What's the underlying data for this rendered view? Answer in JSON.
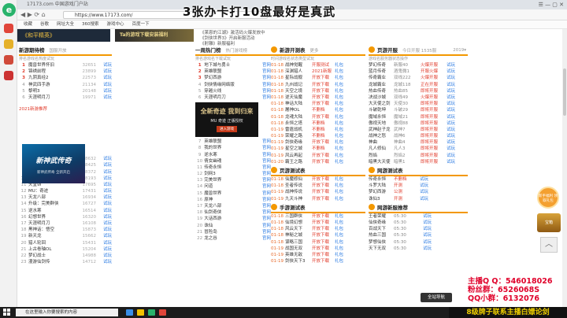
{
  "browser": {
    "tab_title": "17173.com 中国游戏门户站",
    "url": "https://www.17173.com/",
    "nav_glyphs": "◀ ▶ ⟳ ⌂",
    "win_controls": "☰ — ▢ ✕"
  },
  "bookmarks": [
    "收藏",
    "谷歌",
    "网址大全",
    "360搜索",
    "游戏中心",
    "百度一下"
  ],
  "banner": "《和平精英》",
  "fengkuang": "Ta的游戏下载安装福利",
  "top_notes": [
    "《莱恩的江湖》激活码火爆发放中",
    "《剑侠世界3》开启新服活动",
    "《射雕》新服福利"
  ],
  "overlay_title": "3张办卡打10盘最好是真武",
  "col1": {
    "title": "新游期待榜",
    "sub": "国服开放",
    "hdr": [
      "排名",
      "游戏名",
      "热度",
      "试玩"
    ],
    "rows": [
      [
        "1",
        "魔兽世界怀旧",
        "32651",
        "试玩"
      ],
      [
        "2",
        "锦绣前程",
        "23899",
        "试玩"
      ],
      [
        "3",
        "九阴真经2",
        "22573",
        "试玩"
      ],
      [
        "4",
        "神武四手游",
        "21134",
        "试玩"
      ],
      [
        "5",
        "黎明3",
        "20148",
        "试玩"
      ],
      [
        "6",
        "天涯明月刀",
        "19971",
        "试玩"
      ]
    ],
    "ad_title": "2021新游推荐",
    "img_text": "新神武传奇",
    "img_cap": "新神武传奇 全新开启",
    "rows2": [
      [
        "7",
        "神谱",
        "18632",
        "试玩"
      ],
      [
        "8",
        "流星蝴蝶剑",
        "18425",
        "试玩"
      ],
      [
        "9",
        "BBQ欢乐",
        "18372",
        "试玩"
      ],
      [
        "10",
        "提灯与地下城",
        "18193",
        "试玩"
      ],
      [
        "11",
        "天堂W",
        "17695",
        "试玩"
      ],
      [
        "12",
        "MU：奇迹",
        "17431",
        "试玩"
      ],
      [
        "13",
        "天龙八部",
        "16934",
        "试玩"
      ],
      [
        "14",
        "升级：完美群侠",
        "16727",
        "试玩"
      ],
      [
        "15",
        "逆水寒",
        "16514",
        "试玩"
      ],
      [
        "16",
        "幻想世界",
        "16320",
        "试玩"
      ],
      [
        "17",
        "天涯明月刀",
        "16108",
        "试玩"
      ],
      [
        "18",
        "黑神话：悟空",
        "15873",
        "试玩"
      ],
      [
        "19",
        "新天龙",
        "15662",
        "试玩"
      ],
      [
        "20",
        "猎人轮回",
        "15431",
        "试玩"
      ],
      [
        "21",
        "上古卷轴OL",
        "15204",
        "试玩"
      ],
      [
        "22",
        "梦幻战士",
        "14988",
        "试玩"
      ],
      [
        "23",
        "漫游仙剑传",
        "14712",
        "试玩"
      ]
    ]
  },
  "col2": {
    "title": "一周热门榜",
    "sub": "热门游戏榜",
    "hdr": [
      "排名",
      "游戏名",
      "下载",
      "试玩"
    ],
    "rows": [
      [
        "1",
        "地下城与勇士",
        "",
        "官网"
      ],
      [
        "2",
        "英雄联盟",
        "",
        "官网"
      ],
      [
        "3",
        "梦幻西游",
        "",
        "官网"
      ],
      [
        "4",
        "剑侠情缘网络版",
        "",
        "官网"
      ],
      [
        "5",
        "穿越火线",
        "",
        "官网"
      ],
      [
        "6",
        "天涯明月刀",
        "",
        "官网"
      ]
    ],
    "mu_title": "全新奇迹 我到归来",
    "mu_sub": "MU 奇迹 正版授权",
    "mu_btn": "进入游戏",
    "rows2": [
      [
        "7",
        "英雄联盟",
        "",
        "官网"
      ],
      [
        "8",
        "我的世界",
        "",
        "官网"
      ],
      [
        "9",
        "逆水寒",
        "",
        "官网"
      ],
      [
        "10",
        "倩女幽魂",
        "",
        "官网"
      ],
      [
        "11",
        "传奇永恒",
        "",
        "官网"
      ],
      [
        "12",
        "剑网3",
        "",
        "官网"
      ],
      [
        "13",
        "完美世界",
        "",
        "官网"
      ],
      [
        "14",
        "问道",
        "",
        "官网"
      ],
      [
        "15",
        "魔兽世界",
        "",
        "官网"
      ],
      [
        "16",
        "原神",
        "",
        "官网"
      ],
      [
        "17",
        "天龙八部",
        "",
        "官网"
      ],
      [
        "18",
        "仙剑奇侠",
        "",
        "官网"
      ],
      [
        "19",
        "大话西游",
        "",
        "官网"
      ],
      [
        "20",
        "诛仙",
        "",
        "官网"
      ],
      [
        "21",
        "冒险岛",
        "",
        "官网"
      ],
      [
        "22",
        "龙之谷",
        "",
        "官网"
      ]
    ]
  },
  "col3": {
    "title": "新游开测表",
    "more": "更多",
    "hdr": [
      "时间",
      "游戏名",
      "状态",
      "类型",
      "试玩"
    ],
    "rows": [
      [
        "01-18",
        "战神觉醒",
        "开服测试",
        "礼包"
      ],
      [
        "01-18",
        "深渊猎人",
        "2021新服",
        "礼包"
      ],
      [
        "01-18",
        "星际战舰",
        "开放下载",
        "礼包"
      ],
      [
        "01-18",
        "九州战记",
        "开放下载",
        "礼包"
      ],
      [
        "01-18",
        "天空之境",
        "开放下载",
        "礼包"
      ],
      [
        "01-18",
        "逆天仙魔",
        "开放下载",
        "礼包"
      ],
      [
        "01-18",
        "神话大陆",
        "开放下载",
        "礼包"
      ],
      [
        "01-18",
        "屠神OL",
        "不删档",
        "礼包"
      ],
      [
        "01-18",
        "龙魂大陆",
        "开放下载",
        "礼包"
      ],
      [
        "01-18",
        "永恒之塔",
        "不删档",
        "礼包"
      ],
      [
        "01-19",
        "雷霆战机",
        "不删档",
        "礼包"
      ],
      [
        "01-19",
        "荣耀之路",
        "不删档",
        "礼包"
      ],
      [
        "01-19",
        "剑侠奇缘",
        "开放下载",
        "礼包"
      ],
      [
        "01-19",
        "星空之城",
        "不删档",
        "礼包"
      ],
      [
        "01-19",
        "风云再起",
        "开放下载",
        "礼包"
      ],
      [
        "01-20",
        "霸王之路",
        "开放下载",
        "礼包"
      ]
    ],
    "sec2": "页游测试表",
    "rows2": [
      [
        "01-18",
        "仙魔修仙",
        "开放下载",
        "礼包"
      ],
      [
        "01-18",
        "圣者传说",
        "开放下载",
        "礼包"
      ],
      [
        "01-19",
        "战神传说",
        "开放下载",
        "礼包"
      ],
      [
        "01-19",
        "九天斗神",
        "开放下载",
        "礼包"
      ]
    ],
    "sec3": "手游测试表",
    "rows3": [
      [
        "01-18",
        "三国群侠",
        "开放下载",
        "礼包"
      ],
      [
        "01-18",
        "仙境幻想",
        "开放下载",
        "礼包"
      ],
      [
        "01-18",
        "风云天下",
        "开放下载",
        "礼包"
      ],
      [
        "01-18",
        "神秘之城",
        "开放下载",
        "礼包"
      ],
      [
        "01-18",
        "谋略三国",
        "开放下载",
        "礼包"
      ],
      [
        "01-19",
        "战国无双",
        "开放下载",
        "礼包"
      ],
      [
        "01-19",
        "英雄无敌",
        "开放下载",
        "礼包"
      ],
      [
        "01-19",
        "剑侠天下3",
        "开放下载",
        "礼包"
      ]
    ]
  },
  "col4": {
    "title": "页游开服",
    "sub": "今日开服 1535服",
    "more": "2019▾",
    "hdr": [
      "游戏名",
      "服务器",
      "状态",
      "操作"
    ],
    "rows": [
      [
        "梦幻传奇",
        "新服40",
        "火爆开服",
        "试玩"
      ],
      [
        "蓝月传奇",
        "酒鬼微1",
        "开服火爆",
        "试玩"
      ],
      [
        "传奇霸业",
        "双线222",
        "火爆开服",
        "试玩"
      ],
      [
        "龙城霸业",
        "龙城118",
        "正在开服",
        "试玩"
      ],
      [
        "热血传奇",
        "热血85",
        "即将开服",
        "试玩"
      ],
      [
        "决战沙城",
        "双线49",
        "火爆开服",
        "试玩"
      ],
      [
        "大天使之剑",
        "天使30",
        "即将开服",
        "试玩"
      ],
      [
        "斗破乾坤",
        "斗破29",
        "即将开服",
        "试玩"
      ],
      [
        "魔域永恒",
        "魔域21",
        "即将开服",
        "试玩"
      ],
      [
        "傲视天地",
        "傲视88",
        "即将开服",
        "试玩"
      ],
      [
        "武神赵子龙",
        "武神7",
        "即将开服",
        "试玩"
      ],
      [
        "战神之怒",
        "战神6",
        "即将开服",
        "试玩"
      ],
      [
        "神曲",
        "神曲4",
        "即将开服",
        "试玩"
      ],
      [
        "凡人修仙",
        "凡人3",
        "即将开服",
        "试玩"
      ],
      [
        "烈焰",
        "烈焰2",
        "即将开服",
        "试玩"
      ],
      [
        "暗黑大天使",
        "暗黑1",
        "即将开服",
        "试玩"
      ]
    ],
    "sec2": "网游测试表",
    "rows2": [
      [
        "传奇永恒",
        "不删档",
        "试玩"
      ],
      [
        "斗罗大陆",
        "开测",
        "试玩"
      ],
      [
        "梦幻西游",
        "公测",
        "试玩"
      ],
      [
        "诛仙3",
        "开测",
        "试玩"
      ]
    ],
    "sec3": "网游新服推荐",
    "rows3": [
      [
        "王者荣耀",
        "05:30",
        "试玩"
      ],
      [
        "仙侠奇缘",
        "05:30",
        "试玩"
      ],
      [
        "百战天下",
        "05:30",
        "试玩"
      ],
      [
        "热血三国",
        "05:30",
        "试玩"
      ],
      [
        "梦想仙侠",
        "05:30",
        "试玩"
      ],
      [
        "天下无双",
        "05:30",
        "试玩"
      ]
    ]
  },
  "side": {
    "bubble": "新手福利 领取礼包",
    "chest": "宝箱",
    "up": "︿"
  },
  "fullnav": "全站导航",
  "streamer": [
    "主播Q Q：546018026",
    "粉丝群：6526068S",
    "QQ小群：6132076",
    "8级牌子联系主播白嫖论剑"
  ],
  "taskbar": {
    "search": "在这里输入你要搜索的内容"
  },
  "colors": {
    "accent": "#f39800",
    "link": "#2a7ae2",
    "hot": "#e03a2a",
    "overlay": "#e0002a"
  }
}
